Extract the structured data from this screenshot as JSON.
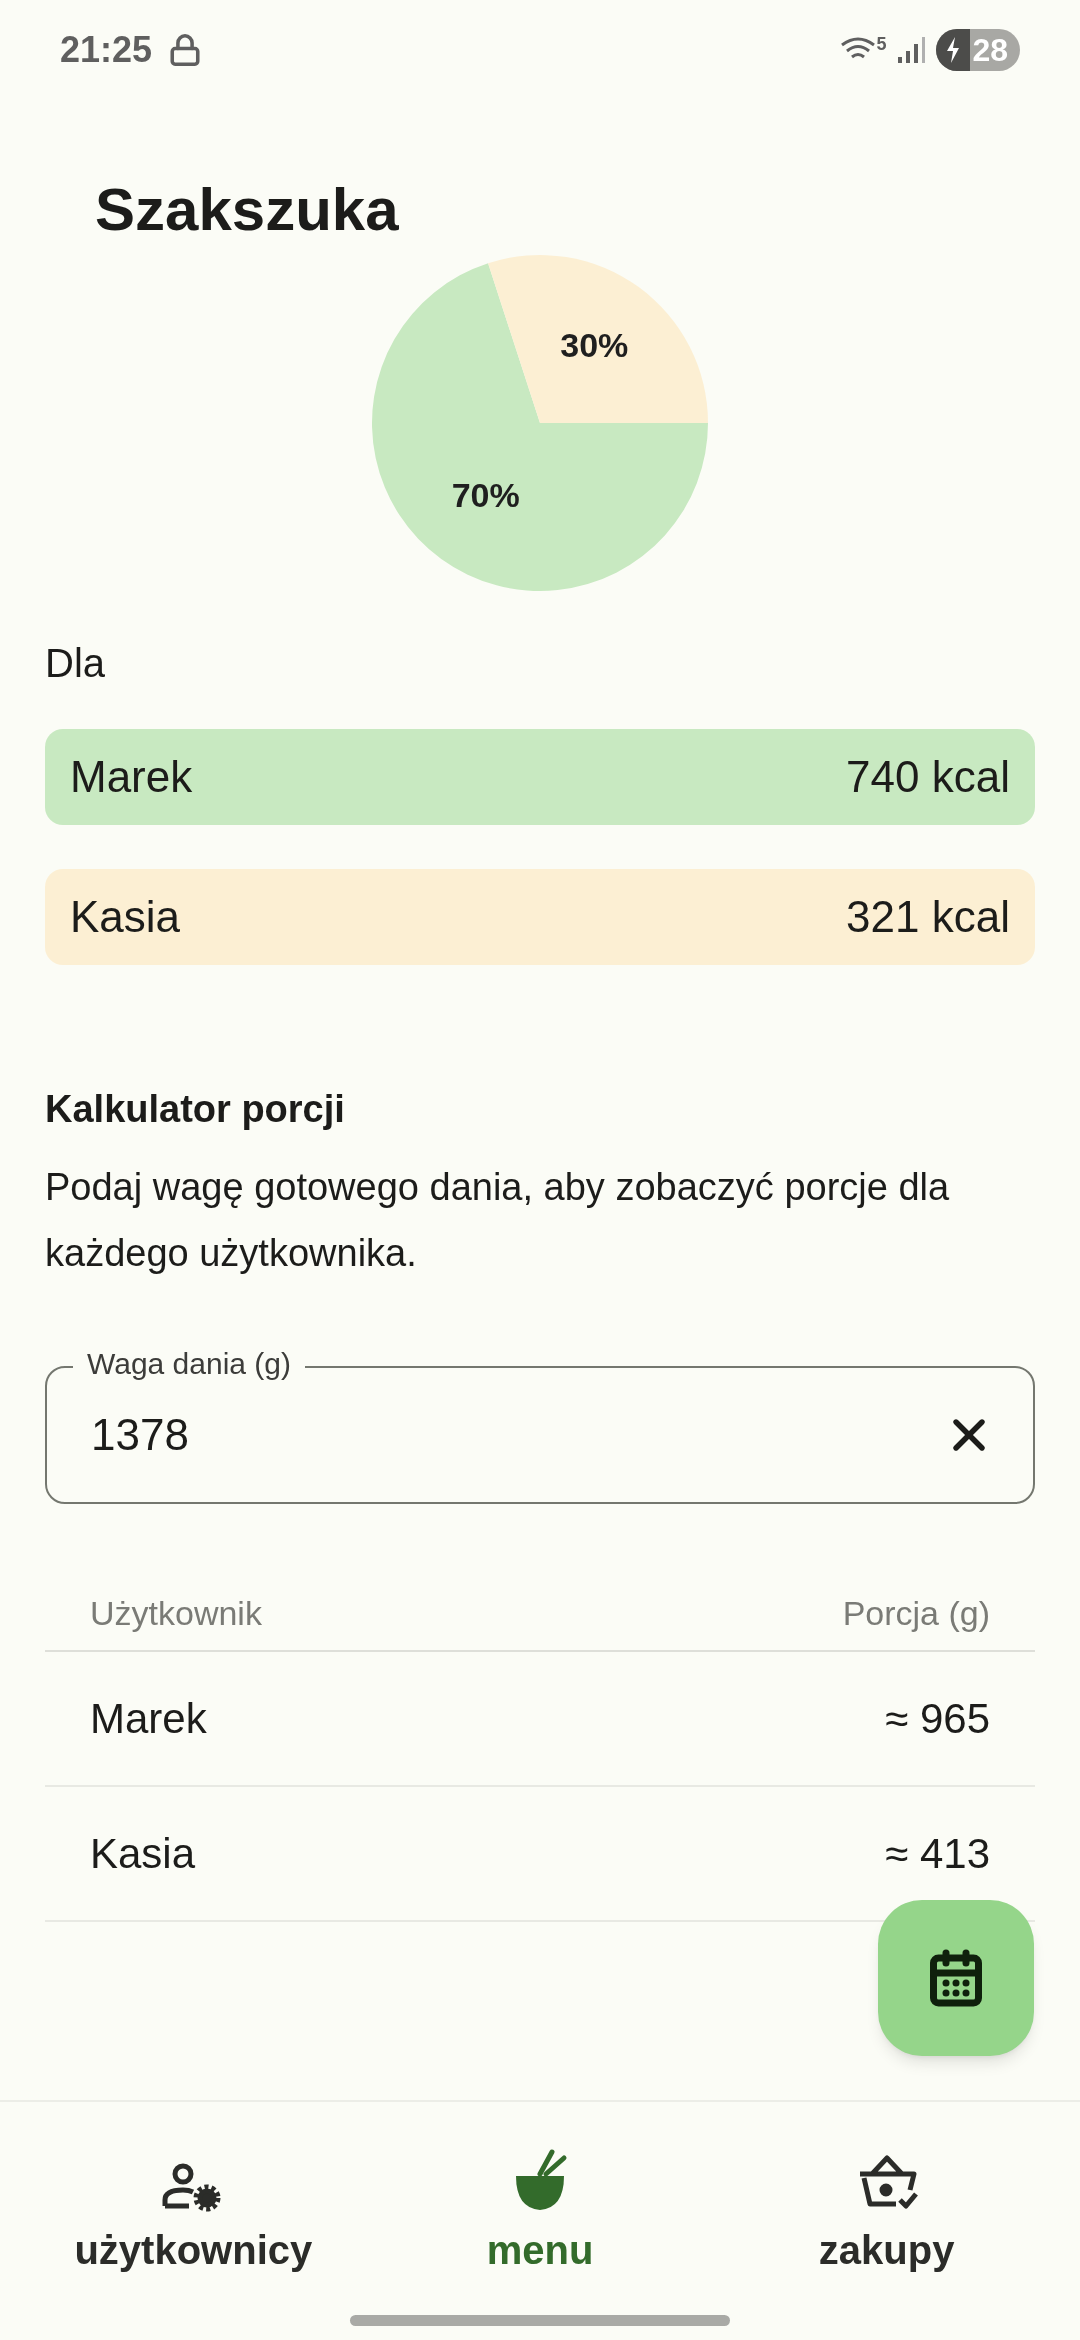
{
  "status_bar": {
    "time": "21:25",
    "battery": "28",
    "network": "5"
  },
  "title": "Szakszuka",
  "chart_data": {
    "type": "pie",
    "values": [
      70,
      30
    ],
    "colors": [
      "#c8e9c1",
      "#fcefd3"
    ],
    "value_labels": [
      "70%",
      "30%"
    ]
  },
  "for_label": "Dla",
  "users": [
    {
      "name": "Marek",
      "kcal": "740 kcal",
      "color": "#c8e9c1"
    },
    {
      "name": "Kasia",
      "kcal": "321 kcal",
      "color": "#fcefd3"
    }
  ],
  "calculator": {
    "title": "Kalkulator porcji",
    "description": "Podaj wagę gotowego dania, aby zobaczyć porcje dla każdego użytkownika.",
    "field": {
      "label": "Waga dania (g)",
      "value": "1378"
    }
  },
  "table": {
    "columns": [
      "Użytkownik",
      "Porcja (g)"
    ],
    "rows": [
      [
        "Marek",
        "≈ 965"
      ],
      [
        "Kasia",
        "≈ 413"
      ]
    ]
  },
  "nav": [
    {
      "label": "użytkownicy",
      "kind": "users",
      "selected": false
    },
    {
      "label": "menu",
      "kind": "bowl",
      "selected": true
    },
    {
      "label": "zakupy",
      "kind": "basket",
      "selected": false
    }
  ]
}
